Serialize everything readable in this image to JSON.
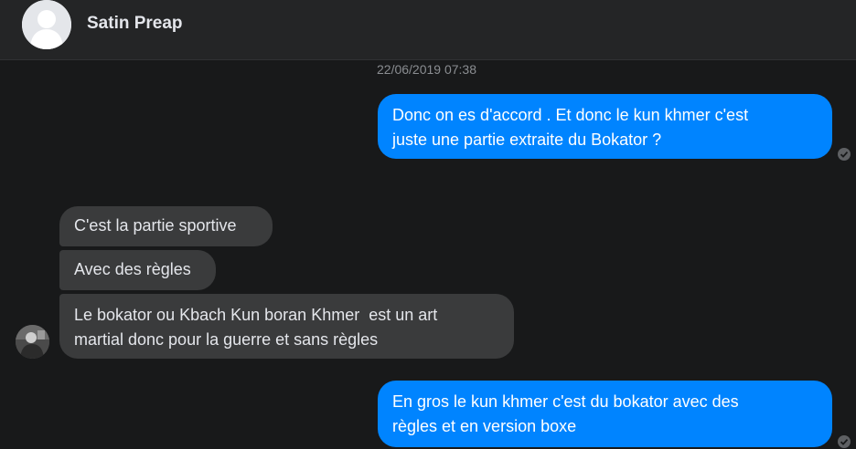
{
  "header": {
    "contact_name": "Satin Preap"
  },
  "thread": {
    "timestamp": "22/06/2019 07:38",
    "messages": [
      {
        "direction": "outgoing",
        "lines": [
          "Donc on es d'accord . Et donc le kun khmer c'est",
          "juste une partie extraite du Bokator ?"
        ]
      },
      {
        "direction": "incoming",
        "lines": [
          "C'est la partie sportive"
        ]
      },
      {
        "direction": "incoming",
        "lines": [
          "Avec des règles"
        ]
      },
      {
        "direction": "incoming",
        "lines": [
          "Le bokator ou Kbach Kun boran Khmer  est un art",
          "martial donc pour la guerre et sans règles"
        ]
      },
      {
        "direction": "outgoing",
        "lines": [
          "En gros le kun khmer c'est du bokator avec des",
          "règles et en version boxe"
        ]
      }
    ]
  },
  "colors": {
    "outgoing_bubble": "#0084ff",
    "incoming_bubble": "#3a3b3c",
    "background": "#18191a"
  }
}
